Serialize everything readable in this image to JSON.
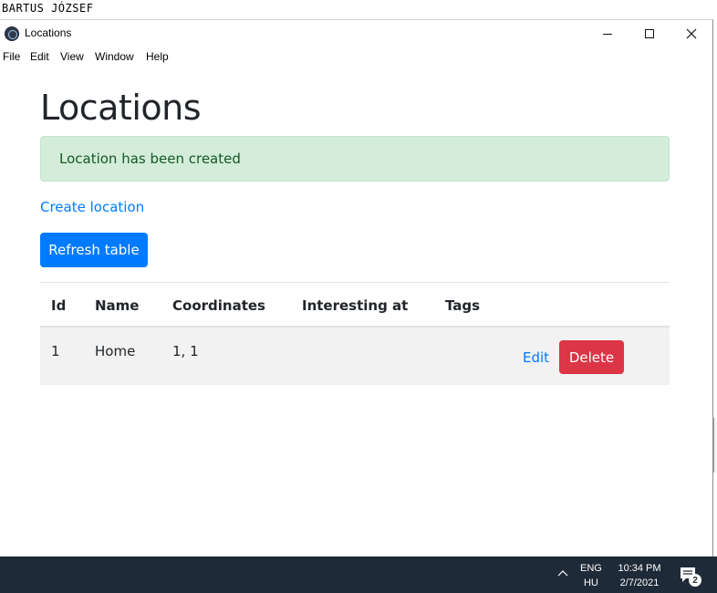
{
  "caption": "BARTUS JÓZSEF",
  "window": {
    "title": "Locations",
    "menu": [
      "File",
      "Edit",
      "View",
      "Window",
      "Help"
    ]
  },
  "page": {
    "heading": "Locations",
    "alert": "Location has been created",
    "create_link": "Create location",
    "refresh_button": "Refresh table"
  },
  "table": {
    "headers": [
      "Id",
      "Name",
      "Coordinates",
      "Interesting at",
      "Tags"
    ],
    "rows": [
      {
        "id": "1",
        "name": "Home",
        "coordinates": "1, 1",
        "interesting_at": "",
        "tags": "",
        "edit_label": "Edit",
        "delete_label": "Delete"
      }
    ]
  },
  "taskbar": {
    "lang_top": "ENG",
    "lang_bottom": "HU",
    "time": "10:34 PM",
    "date": "2/7/2021",
    "notification_count": "2"
  },
  "colors": {
    "primary": "#007bff",
    "danger": "#dc3545",
    "success_bg": "#d4edda",
    "success_text": "#155724",
    "taskbar": "#1f2a38"
  }
}
